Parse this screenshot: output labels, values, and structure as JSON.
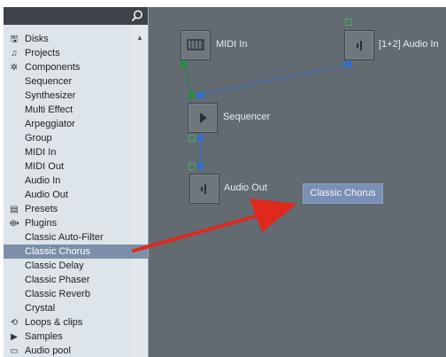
{
  "sidebar": {
    "items": [
      {
        "label": "Disks",
        "level": "top",
        "icon": "disk-icon"
      },
      {
        "label": "Projects",
        "level": "top",
        "icon": "music-note-icon"
      },
      {
        "label": "Components",
        "level": "top",
        "icon": "gear-icon"
      },
      {
        "label": "Sequencer",
        "level": "sub"
      },
      {
        "label": "Synthesizer",
        "level": "sub"
      },
      {
        "label": "Multi Effect",
        "level": "sub"
      },
      {
        "label": "Arpeggiator",
        "level": "sub"
      },
      {
        "label": "Group",
        "level": "sub"
      },
      {
        "label": "MIDI In",
        "level": "sub"
      },
      {
        "label": "MIDI Out",
        "level": "sub"
      },
      {
        "label": "Audio In",
        "level": "sub"
      },
      {
        "label": "Audio Out",
        "level": "sub"
      },
      {
        "label": "Presets",
        "level": "top",
        "icon": "preset-icon"
      },
      {
        "label": "Plugins",
        "level": "top",
        "icon": "plugin-icon"
      },
      {
        "label": "Classic Auto-Filter",
        "level": "sub"
      },
      {
        "label": "Classic Chorus",
        "level": "sub",
        "selected": true
      },
      {
        "label": "Classic Delay",
        "level": "sub"
      },
      {
        "label": "Classic Phaser",
        "level": "sub"
      },
      {
        "label": "Classic Reverb",
        "level": "sub"
      },
      {
        "label": "Crystal",
        "level": "sub"
      },
      {
        "label": "Loops & clips",
        "level": "top",
        "icon": "loop-icon"
      },
      {
        "label": "Samples",
        "level": "top",
        "icon": "sample-icon"
      },
      {
        "label": "Audio pool",
        "level": "top",
        "icon": "folder-icon"
      }
    ]
  },
  "canvas": {
    "nodes": {
      "midi_in": "MIDI In",
      "audio_in": "[1+2] Audio In",
      "sequencer": "Sequencer",
      "audio_out": "Audio Out"
    },
    "drag_chip": "Classic Chorus"
  },
  "colors": {
    "canvas_bg": "#636b72",
    "sidebar_bg": "#dde4ea",
    "selected_bg": "#7d8fa8",
    "wire_blue": "#2d6fd2",
    "wire_green": "#1f8f3e",
    "arrow_red": "#e0281d"
  }
}
